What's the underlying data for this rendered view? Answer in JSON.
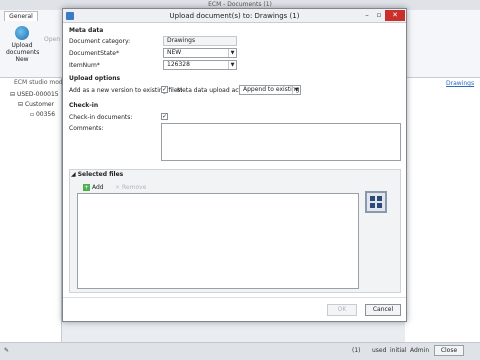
{
  "app": {
    "title": "ECM - Documents (1)",
    "tab_general": "General",
    "upload_btn": "Upload documents New",
    "open_btn": "Open",
    "studio_label": "ECM studio model",
    "tree": [
      "USED-000015",
      "Customer",
      "00356"
    ],
    "drawings_link": "Drawings",
    "status": {
      "count": "(1)",
      "user": "used",
      "state": "initial",
      "admin": "Admin",
      "close": "Close"
    }
  },
  "dialog": {
    "title": "Upload document(s) to: Drawings (1)",
    "meta_header": "Meta data",
    "category_label": "Document category:",
    "category_value": "Drawings",
    "state_label": "DocumentState*",
    "state_value": "NEW",
    "itemnum_label": "ItemNum*",
    "itemnum_value": "126328",
    "upload_header": "Upload options",
    "new_version_label": "Add as a new version to existing files:",
    "meta_action_label": "Meta data upload action:",
    "meta_action_value": "Append to existing",
    "checkin_header": "Check-in",
    "checkin_label": "Check-in documents:",
    "comments_label": "Comments:",
    "comments_value": "",
    "selected_files_header": "Selected files",
    "add_label": "Add",
    "remove_label": "Remove",
    "ok_label": "OK",
    "cancel_label": "Cancel"
  }
}
